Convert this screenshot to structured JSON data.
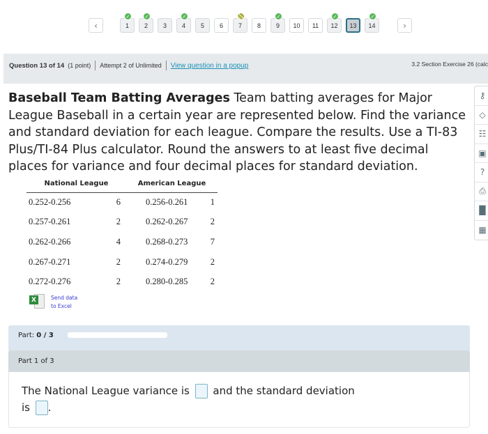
{
  "pager": {
    "items": [
      {
        "label": "1",
        "status": "correct"
      },
      {
        "label": "2",
        "status": "correct"
      },
      {
        "label": "3",
        "status": "visited"
      },
      {
        "label": "4",
        "status": "correct"
      },
      {
        "label": "5",
        "status": "visited"
      },
      {
        "label": "6",
        "status": "none"
      },
      {
        "label": "7",
        "status": "partial"
      },
      {
        "label": "8",
        "status": "none"
      },
      {
        "label": "9",
        "status": "correct"
      },
      {
        "label": "10",
        "status": "none"
      },
      {
        "label": "11",
        "status": "none"
      },
      {
        "label": "12",
        "status": "correct"
      },
      {
        "label": "13",
        "status": "current"
      },
      {
        "label": "14",
        "status": "correct"
      }
    ],
    "prev_icon": "chevron-left-icon",
    "next_icon": "chevron-right-icon"
  },
  "header": {
    "question": "Question 13 of 14",
    "points": "(1 point)",
    "attempt": "Attempt 2 of Unlimited",
    "popup_link": "View question in a popup",
    "section": "3.2 Section Exercise 26 (calc"
  },
  "question": {
    "title": "Baseball Team Batting Averages",
    "body": " Team batting averages for Major League Baseball in a certain year are represented below. Find the variance and standard deviation for each league. Compare the results. Use a TI-83 Plus/TI-84 Plus calculator. Round the answers to at least five decimal places for variance and four decimal places for standard deviation."
  },
  "table": {
    "headers": [
      "National League",
      "American League"
    ],
    "rows": [
      [
        "0.252-0.256",
        "6",
        "0.256-0.261",
        "1"
      ],
      [
        "0.257-0.261",
        "2",
        "0.262-0.267",
        "2"
      ],
      [
        "0.262-0.266",
        "4",
        "0.268-0.273",
        "7"
      ],
      [
        "0.267-0.271",
        "2",
        "0.274-0.279",
        "2"
      ],
      [
        "0.272-0.276",
        "2",
        "0.280-0.285",
        "2"
      ]
    ]
  },
  "excel": {
    "line1": "Send data",
    "line2": "to Excel"
  },
  "part": {
    "label": "Part: ",
    "value": "0 / 3",
    "progress": 0
  },
  "part1": {
    "title": "Part 1 of 3",
    "text1": "The National League variance is",
    "text2": "and the standard deviation",
    "text3": "is",
    "text4": "."
  },
  "tools": [
    "key-icon",
    "direction-sign-icon",
    "review-icon",
    "textbook-icon",
    "help-icon",
    "print-icon",
    "chart-icon",
    "calculator-icon"
  ],
  "colors": {
    "correct": "#5cb85c",
    "link": "#1b8fb5",
    "current_border": "#2b6f84"
  }
}
